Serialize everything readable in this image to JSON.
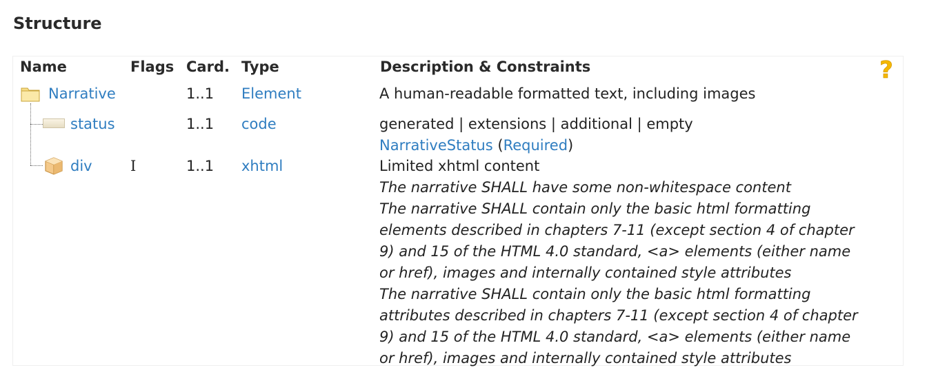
{
  "title": "Structure",
  "headers": {
    "name": "Name",
    "flags": "Flags",
    "card": "Card.",
    "type": "Type",
    "desc": "Description & Constraints"
  },
  "rows": [
    {
      "name": "Narrative",
      "flags": "",
      "card": "1..1",
      "type": "Element",
      "icon": "folder-icon",
      "desc": [
        "A human-readable formatted text, including images"
      ]
    },
    {
      "name": "status",
      "flags": "",
      "card": "1..1",
      "type": "code",
      "icon": "primitive-icon",
      "desc": [
        "generated | extensions | additional | empty"
      ],
      "binding_name": "NarrativeStatus",
      "binding_open": " (",
      "binding_strength": "Required",
      "binding_close": ")"
    },
    {
      "name": "div",
      "flags": "I",
      "card": "1..1",
      "type": "xhtml",
      "icon": "datatype-icon",
      "desc": [
        "Limited xhtml content"
      ],
      "constraints": [
        "The narrative SHALL have some non-whitespace content",
        "The narrative SHALL contain only the basic html formatting",
        "elements described in chapters 7-11 (except section 4 of chapter",
        "9) and 15 of the HTML 4.0 standard, <a> elements (either name",
        "or href), images and internally contained style attributes",
        "The narrative SHALL contain only the basic html formatting",
        "attributes described in chapters 7-11 (except section 4 of chapter",
        "9) and 15 of the HTML 4.0 standard, <a> elements (either name",
        "or href), images and internally contained style attributes"
      ]
    }
  ],
  "help_icon": "help-icon",
  "colors": {
    "link": "#2f7dc0",
    "folder": "#f2d16b",
    "help": "#f5b800"
  }
}
